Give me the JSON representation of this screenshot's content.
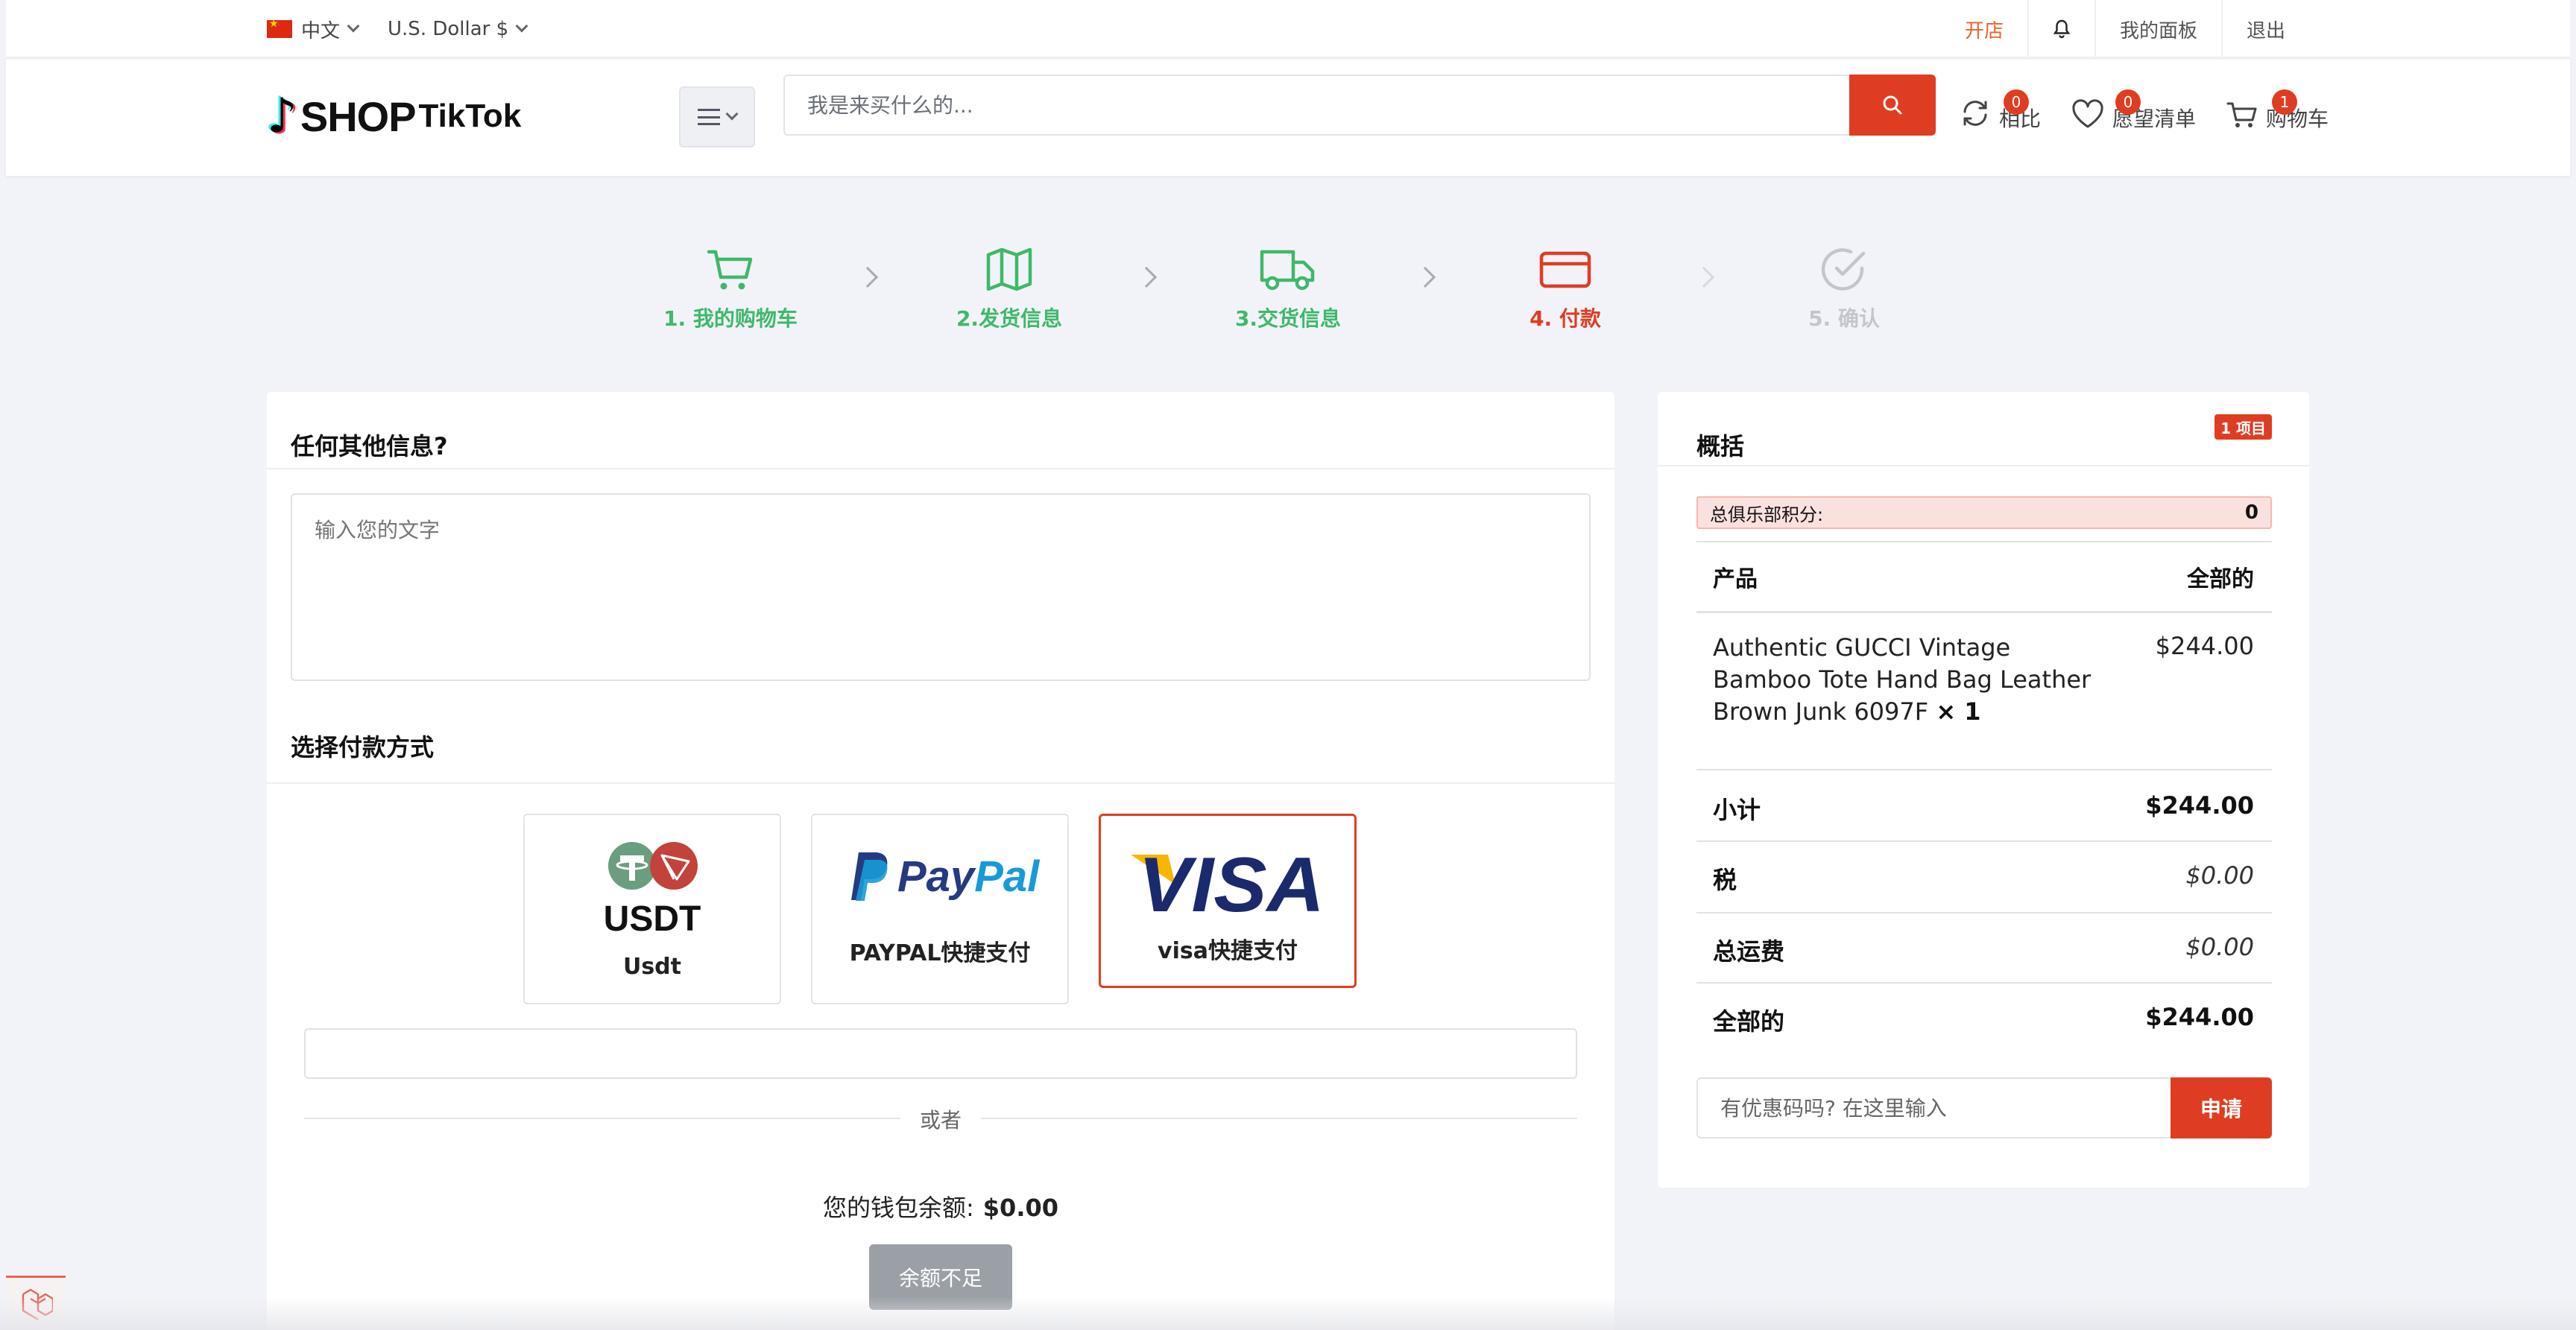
{
  "topbar": {
    "language": "中文",
    "currency": "U.S. Dollar $",
    "open_shop": "开店",
    "dashboard": "我的面板",
    "logout": "退出"
  },
  "header": {
    "logo_shop": "SHOP",
    "logo_tiktok": "TikTok",
    "search_placeholder": "我是来买什么的...",
    "compare": {
      "label": "相比",
      "count": "0"
    },
    "wishlist": {
      "label": "愿望清单",
      "count": "0"
    },
    "cart": {
      "label": "购物车",
      "count": "1"
    }
  },
  "steps": [
    {
      "label": "1. 我的购物车",
      "state": "done",
      "icon": "cart-icon"
    },
    {
      "label": "2.发货信息",
      "state": "done",
      "icon": "map-icon"
    },
    {
      "label": "3.交货信息",
      "state": "done",
      "icon": "truck-icon"
    },
    {
      "label": "4. 付款",
      "state": "active",
      "icon": "credit-card-icon"
    },
    {
      "label": "5. 确认",
      "state": "todo",
      "icon": "check-circle-icon"
    }
  ],
  "additional_info": {
    "title": "任何其他信息?",
    "placeholder": "输入您的文字"
  },
  "payment": {
    "title": "选择付款方式",
    "options": [
      {
        "logo_text": "USDT",
        "label": "Usdt",
        "selected": false
      },
      {
        "logo_text_pay": "Pay",
        "logo_text_pal": "Pal",
        "label": "PAYPAL快捷支付",
        "selected": false
      },
      {
        "logo_text": "VISA",
        "label": "visa快捷支付",
        "selected": true
      }
    ],
    "or_text": "或者",
    "wallet_label": "您的钱包余额:",
    "wallet_value": "$0.00",
    "insufficient_button": "余额不足"
  },
  "summary": {
    "title": "概括",
    "items_badge": "1 项目",
    "club_points_label": "总俱乐部积分:",
    "club_points_value": "0",
    "col_product": "产品",
    "col_total": "全部的",
    "product_name": "Authentic GUCCI Vintage Bamboo Tote Hand Bag Leather Brown Junk 6097F",
    "product_qty": "× 1",
    "product_price": "$244.00",
    "subtotal_label": "小计",
    "subtotal_value": "$244.00",
    "tax_label": "税",
    "tax_value": "$0.00",
    "shipping_label": "总运费",
    "shipping_value": "$0.00",
    "total_label": "全部的",
    "total_value": "$244.00",
    "coupon_placeholder": "有优惠码吗? 在这里输入",
    "coupon_button": "申请"
  },
  "colors": {
    "accent": "#df3d22",
    "step_done": "#3fb86b",
    "step_todo": "#c2c6cc",
    "open_shop": "#e8632d"
  }
}
